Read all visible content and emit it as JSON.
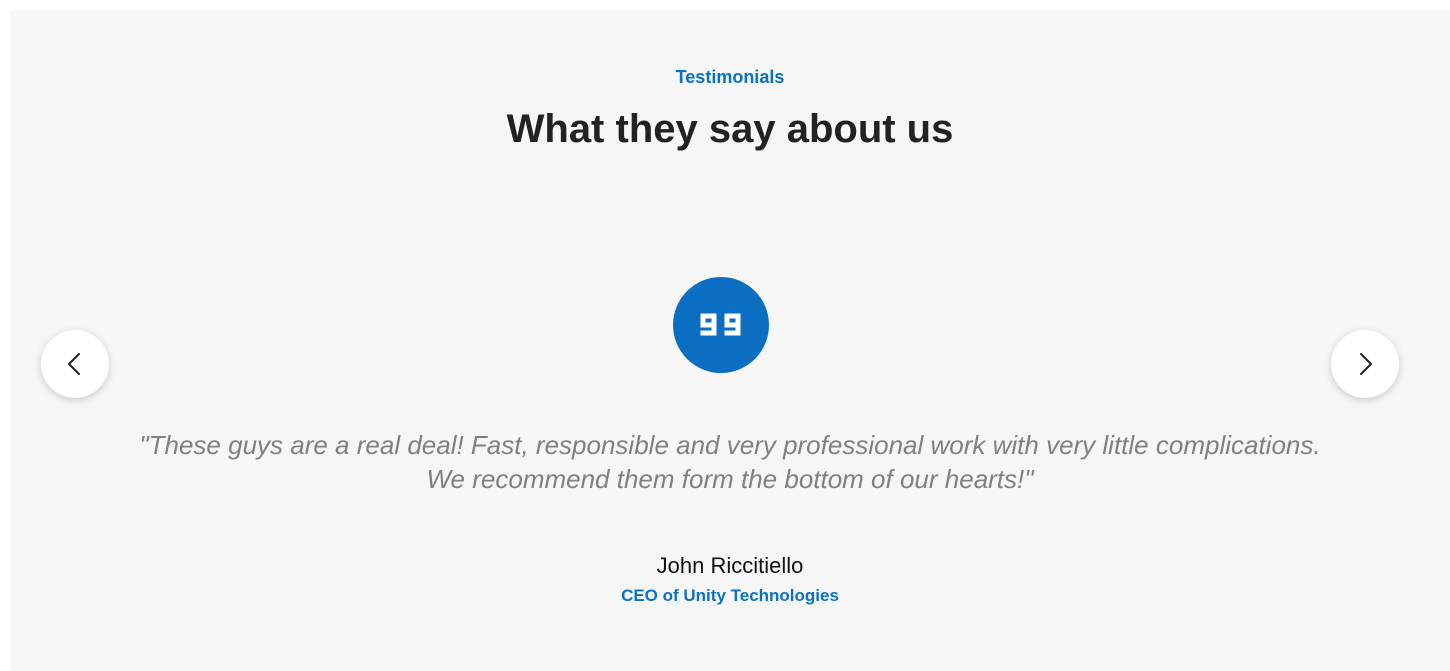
{
  "section": {
    "eyebrow": "Testimonials",
    "title": "What they say about us"
  },
  "testimonial": {
    "quote": "\"These guys are a real deal! Fast, responsible and very professional work with very little complications. We recommend them form the bottom of our hearts!\"",
    "author_name": "John Riccitiello",
    "author_role": "CEO of Unity Technologies"
  },
  "carousel": {
    "prev_icon": "chevron-left-icon",
    "next_icon": "chevron-right-icon"
  },
  "colors": {
    "accent": "#0a72c4",
    "background": "#f6f6f6",
    "heading": "#222222",
    "quote_text": "#808080"
  },
  "icons": {
    "badge": "quote-icon"
  }
}
